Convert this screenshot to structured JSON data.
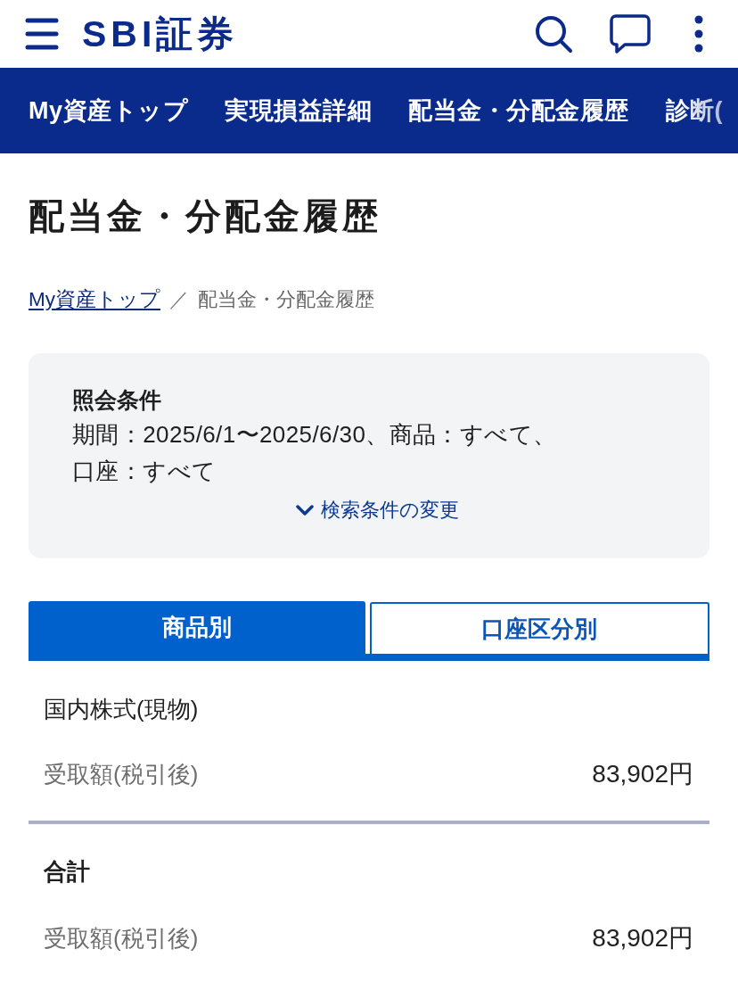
{
  "header": {
    "logo": "SBI証券"
  },
  "nav": {
    "items": [
      {
        "label": "My資産トップ"
      },
      {
        "label": "実現損益詳細"
      },
      {
        "label": "配当金・分配金履歴"
      },
      {
        "label": "診断("
      }
    ]
  },
  "page": {
    "title": "配当金・分配金履歴"
  },
  "breadcrumb": {
    "link": "My資産トップ",
    "separator": "／",
    "current": "配当金・分配金履歴"
  },
  "conditions": {
    "heading": "照会条件",
    "lines": [
      "期間：2025/6/1〜2025/6/30、商品：すべて、",
      "口座：すべて"
    ],
    "change_link": "検索条件の変更"
  },
  "tabs": [
    {
      "label": "商品別",
      "selected": true
    },
    {
      "label": "口座区分別",
      "selected": false
    }
  ],
  "sections": [
    {
      "kind": "category",
      "title": "国内株式(現物)",
      "rows": [
        {
          "label": "受取額(税引後)",
          "value": "83,902円"
        }
      ]
    },
    {
      "kind": "total",
      "title": "合計",
      "rows": [
        {
          "label": "受取額(税引後)",
          "value": "83,902円"
        }
      ]
    }
  ]
}
